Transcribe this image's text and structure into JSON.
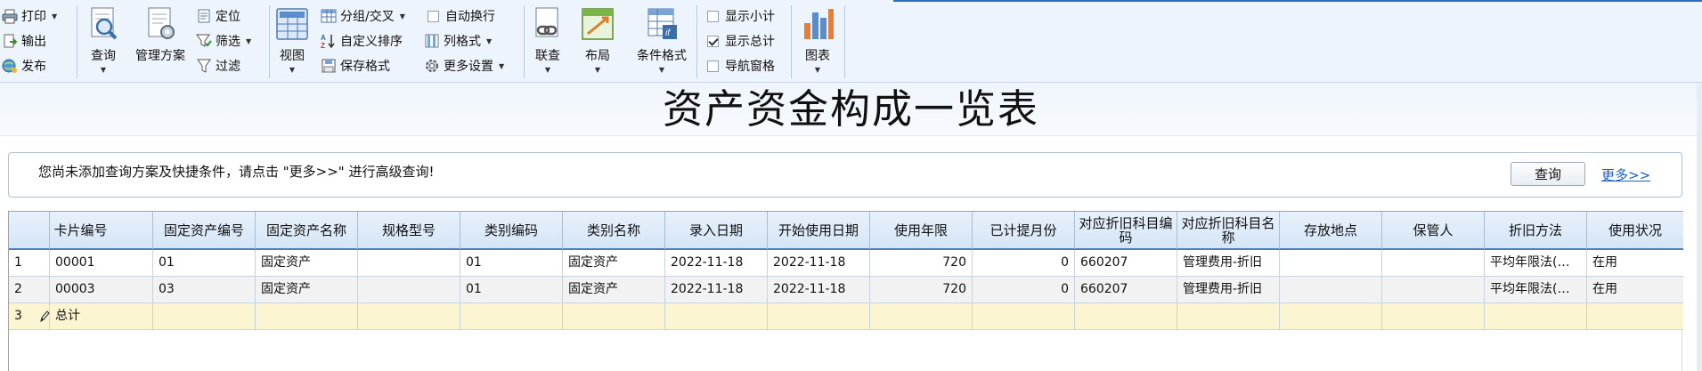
{
  "toolbar": {
    "print": "打印",
    "export": "输出",
    "publish": "发布",
    "query": "查询",
    "manage_scheme": "管理方案",
    "locate": "定位",
    "filter_select": "筛选",
    "filter": "过滤",
    "view": "视图",
    "group_cross": "分组/交叉",
    "custom_sort": "自定义排序",
    "save_format": "保存格式",
    "auto_wrap": "自动换行",
    "column_format": "列格式",
    "more_settings": "更多设置",
    "link_query": "联查",
    "layout": "布局",
    "conditional_format": "条件格式",
    "show_subtotal": "显示小计",
    "show_total": "显示总计",
    "nav_pane": "导航窗格",
    "chart": "图表",
    "checks": {
      "auto_wrap": false,
      "show_subtotal": false,
      "show_total": true,
      "nav_pane": false
    }
  },
  "report": {
    "title": "资产资金构成一览表"
  },
  "querybar": {
    "message": "您尚未添加查询方案及快捷条件，请点击 \"更多>>\" 进行高级查询!",
    "query_button": "查询",
    "more_link": "更多>>"
  },
  "table": {
    "headers": [
      "卡片编号",
      "固定资产编号",
      "固定资产名称",
      "规格型号",
      "类别编码",
      "类别名称",
      "录入日期",
      "开始使用日期",
      "使用年限",
      "已计提月份",
      "对应折旧科目编码",
      "对应折旧科目名称",
      "存放地点",
      "保管人",
      "折旧方法",
      "使用状况"
    ],
    "rows": [
      {
        "no": "1",
        "cells": [
          "00001",
          "01",
          "固定资产",
          "",
          "01",
          "固定资产",
          "2022-11-18",
          "2022-11-18",
          "720",
          "0",
          "660207",
          "管理费用-折旧",
          "",
          "",
          "平均年限法(…",
          "在用"
        ]
      },
      {
        "no": "2",
        "cells": [
          "00003",
          "03",
          "固定资产",
          "",
          "01",
          "固定资产",
          "2022-11-18",
          "2022-11-18",
          "720",
          "0",
          "660207",
          "管理费用-折旧",
          "",
          "",
          "平均年限法(…",
          "在用"
        ]
      },
      {
        "no": "3",
        "cells": [
          "总计",
          "",
          "",
          "",
          "",
          "",
          "",
          "",
          "",
          "",
          "",
          "",
          "",
          "",
          "",
          ""
        ]
      }
    ]
  }
}
